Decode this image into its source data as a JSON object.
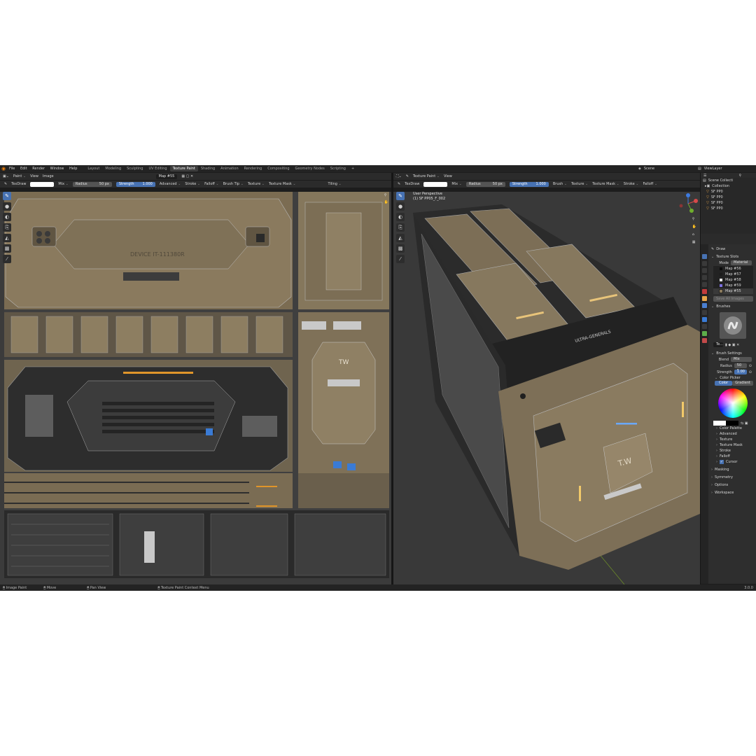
{
  "menubar": {
    "items": [
      "File",
      "Edit",
      "Render",
      "Window",
      "Help"
    ],
    "workspaces": [
      "Layout",
      "Modeling",
      "Sculpting",
      "UV Editing",
      "Texture Paint",
      "Shading",
      "Animation",
      "Rendering",
      "Compositing",
      "Geometry Nodes",
      "Scripting"
    ],
    "active_workspace": "Texture Paint",
    "add_tab": "+",
    "scene": "Scene",
    "view_layer": "ViewLayer"
  },
  "image_editor": {
    "mode": "Paint",
    "view_menu": "View",
    "image_menu": "Image",
    "image_name": "Map #55",
    "tool": {
      "brush": "TexDraw",
      "blend": "Mix",
      "radius_label": "Radius",
      "radius_value": "50 px",
      "strength_label": "Strength",
      "strength_value": "1.000",
      "menus": [
        "Advanced",
        "Stroke",
        "Falloff",
        "Brush Tip",
        "Texture",
        "Texture Mask"
      ],
      "tiling": "Tiling"
    },
    "uv_text": {
      "device_label": "DEVICE IT-111380R",
      "tw_label": "TW"
    }
  },
  "viewport": {
    "mode": "Texture Paint",
    "view_menu": "View",
    "perspective": "User Perspective",
    "object": "(1) SF PP05_F_002",
    "tool": {
      "brush": "TexDraw",
      "blend": "Mix",
      "radius_label": "Radius",
      "radius_value": "50 px",
      "strength_label": "Strength",
      "strength_value": "1.000",
      "menus": [
        "Brush",
        "Texture",
        "Texture Mask",
        "Stroke",
        "Falloff"
      ]
    },
    "model_text": {
      "panel_label": "ULTRA-GENERALS",
      "tw_label": "T.W"
    }
  },
  "outliner": {
    "root": "Scene Collecti",
    "collection": "Collection",
    "items": [
      "SF PP0",
      "SF PP0",
      "SF PP0",
      "SF PP0"
    ]
  },
  "properties": {
    "tool_label": "Draw",
    "texture_slots": {
      "title": "Texture Slots",
      "mode_label": "Mode",
      "mode_value": "Material",
      "slots": [
        {
          "name": "Map #56",
          "color": "#0a0a0a"
        },
        {
          "name": "Map #57",
          "color": "#1b1b1b"
        },
        {
          "name": "Map #58",
          "color": "#e8e8e8"
        },
        {
          "name": "Map #59",
          "color": "#7b6fe0"
        },
        {
          "name": "Map #55",
          "color": "#8a7a5c"
        }
      ],
      "save_all": "Save All Images"
    },
    "brushes": {
      "title": "Brushes",
      "brush_name": "Te..."
    },
    "brush_settings": {
      "title": "Brush Settings",
      "blend_label": "Blend",
      "blend_value": "Mix",
      "radius_label": "Radius",
      "radius_value": "50 p",
      "strength_label": "Strength",
      "strength_value": "1.00"
    },
    "color_picker": {
      "title": "Color Picker",
      "tabs": [
        "Color",
        "Gradient"
      ],
      "active_tab": "Color"
    },
    "subsections": [
      "Color Palette",
      "Advanced",
      "Texture",
      "Texture Mask",
      "Stroke",
      "Falloff",
      "Cursor"
    ],
    "cursor_checked": true,
    "collapsed_sections": [
      "Masking",
      "Symmetry",
      "Options",
      "Workspace"
    ]
  },
  "statusbar": {
    "items": [
      "Image Paint",
      "Move",
      "Pan View",
      "Texture Paint Context Menu"
    ],
    "version": "3.0.0"
  },
  "colors": {
    "accent_blue": "#4772b3",
    "blender_orange": "#e87d0d",
    "panel": "#2e2e2e",
    "header": "#2b2b2b"
  }
}
